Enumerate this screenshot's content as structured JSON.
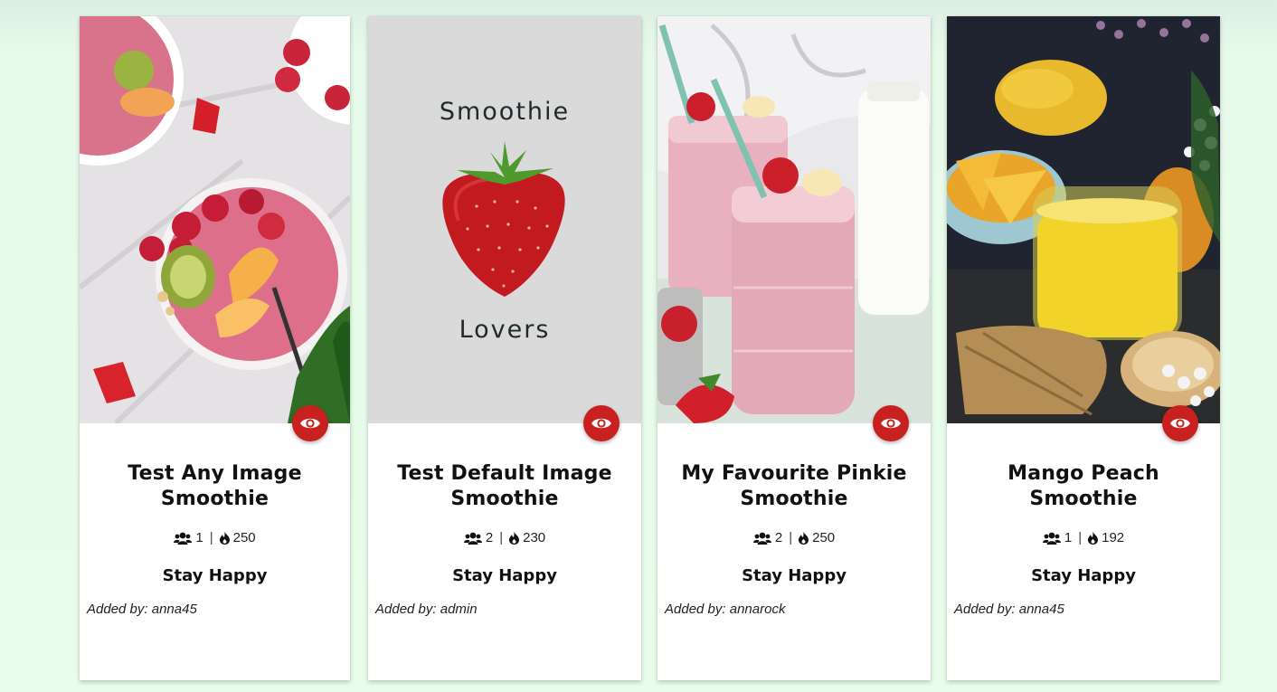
{
  "cards": [
    {
      "title": "Test Any Image Smoothie",
      "servings": "1",
      "separator": "|",
      "calories": "250",
      "motto": "Stay Happy",
      "author_label": "Added by:",
      "author": "anna45"
    },
    {
      "title": "Test Default Image Smoothie",
      "servings": "2",
      "separator": "|",
      "calories": "230",
      "motto": "Stay Happy",
      "author_label": "Added by:",
      "author": "admin",
      "image_text_top": "Smoothie",
      "image_text_bottom": "Lovers"
    },
    {
      "title": "My Favourite Pinkie Smoothie",
      "servings": "2",
      "separator": "|",
      "calories": "250",
      "motto": "Stay Happy",
      "author_label": "Added by:",
      "author": "annarock"
    },
    {
      "title": "Mango Peach Smoothie",
      "servings": "1",
      "separator": "|",
      "calories": "192",
      "motto": "Stay Happy",
      "author_label": "Added by:",
      "author": "anna45"
    }
  ],
  "icons": {
    "servings": "users-icon",
    "calories": "fire-icon",
    "view": "eye-icon"
  },
  "colors": {
    "accent": "#c8201f",
    "background": "#e9fdea",
    "card": "#ffffff"
  }
}
